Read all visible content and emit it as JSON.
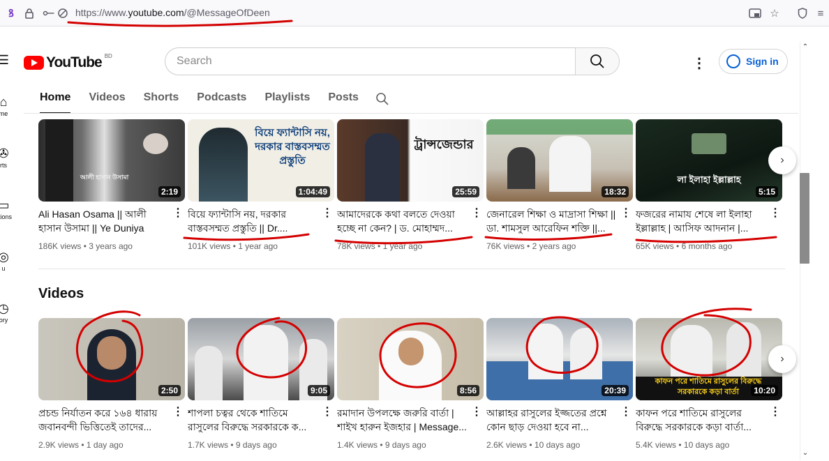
{
  "browser": {
    "url_prefix": "https://www.",
    "url_domain": "youtube.com",
    "url_suffix": "/@MessageOfDeen"
  },
  "left_nav": [
    {
      "label": "me",
      "icon": "home-icon"
    },
    {
      "label": "rts",
      "icon": "shorts-icon"
    },
    {
      "label": "ptions",
      "icon": "subscriptions-icon"
    },
    {
      "label": "u",
      "icon": "you-icon"
    },
    {
      "label": "ory",
      "icon": "history-icon"
    }
  ],
  "header": {
    "logo_text": "YouTube",
    "country_code": "BD",
    "search_placeholder": "Search",
    "signin_label": "Sign in"
  },
  "tabs": [
    "Home",
    "Videos",
    "Shorts",
    "Podcasts",
    "Playlists",
    "Posts"
  ],
  "row1": [
    {
      "title": "Ali Hasan Osama || আলী হাসান উসামা || Ye Duniya Cho...",
      "views": "186K views",
      "age": "3 years ago",
      "duration": "2:19",
      "thumb_text": "আলী হাসান উসামা"
    },
    {
      "title": "বিয়ে ফ্যান্টাসি নয়, দরকার বাস্তবসম্মত প্রস্তুতি || Dr....",
      "views": "101K views",
      "age": "1 year ago",
      "duration": "1:04:49",
      "thumb_text": "বিয়ে ফ্যান্টাসি নয়, দরকার বাস্তবসম্মত প্রস্তুতি"
    },
    {
      "title": "আমাদেরকে কথা বলতে দেওয়া হচ্ছে না কেন? | ড. মোহাম্মদ...",
      "views": "78K views",
      "age": "1 year ago",
      "duration": "25:59",
      "thumb_text": "ট্রান্সজেন্ডার"
    },
    {
      "title": "জেনারেল শিক্ষা ও মাদ্রাসা শিক্ষা || ডা. শামসুল আরেফিন শক্তি ||...",
      "views": "76K views",
      "age": "2 years ago",
      "duration": "18:32",
      "thumb_text": ""
    },
    {
      "title": "ফজরের নামায শেষে লা ইলাহা ইল্লাল্লাহ | আসিফ আদনান |...",
      "views": "65K views",
      "age": "6 months ago",
      "duration": "5:15",
      "thumb_text": "লা ইলাহা ইল্লাল্লাহ"
    }
  ],
  "videos_section": {
    "title": "Videos",
    "items": [
      {
        "title": "প্রচন্ড নির্যাতন করে ১৬৪ ধারায় জবানবন্দী ভিত্তিতেই তাদের...",
        "views": "2.9K views",
        "age": "1 day ago",
        "duration": "2:50"
      },
      {
        "title": "শাপলা চত্বর থেকে শাতিমে রাসুলের বিরুদ্ধে সরকারকে ক...",
        "views": "1.7K views",
        "age": "9 days ago",
        "duration": "9:05"
      },
      {
        "title": "রমাদান উপলক্ষে জরুরি বার্তা | শাইখ হারুন ইজহার | Message...",
        "views": "1.4K views",
        "age": "9 days ago",
        "duration": "8:56"
      },
      {
        "title": "আল্লাহর রাসুলের ইজ্জতের প্রশ্নে কোন ছাড় দেওয়া হবে না...",
        "views": "2.6K views",
        "age": "10 days ago",
        "duration": "20:39"
      },
      {
        "title": "কাফন পরে শাতিমে রাসুলের বিরুদ্ধে সরকারকে কড়া বার্তা...",
        "views": "5.4K views",
        "age": "10 days ago",
        "duration": "10:20",
        "thumb_text": "কাফন পরে শাতিমে রাসুলের বিরুদ্ধে সরকারকে কড়া বার্তা"
      }
    ]
  },
  "meta_separator": "•",
  "colors": {
    "brand": "#ff0000",
    "link": "#065fd4",
    "annotation": "#d40000"
  }
}
